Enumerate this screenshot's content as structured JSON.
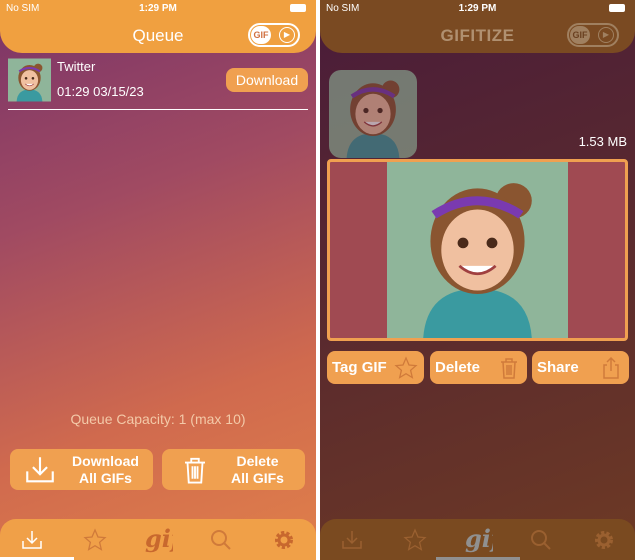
{
  "status": {
    "carrier": "No SIM",
    "time": "1:29 PM"
  },
  "queue_screen": {
    "title": "Queue",
    "toggle_label": "GIF",
    "items": [
      {
        "source": "Twitter",
        "timestamp": "01:29 03/15/23",
        "button": "Download"
      }
    ],
    "capacity": "Queue Capacity: 1 (max 10)",
    "download_all": {
      "line1": "Download",
      "line2": "All GIFs"
    },
    "delete_all": {
      "line1": "Delete",
      "line2": "All GIFs"
    }
  },
  "gifitize_screen": {
    "title": "GIFITIZE",
    "toggle_label": "GIF",
    "file_size": "1.53 MB",
    "actions": [
      {
        "label": "Tag GIF",
        "icon": "star-icon"
      },
      {
        "label": "Delete",
        "icon": "trash-icon"
      },
      {
        "label": "Share",
        "icon": "share-icon"
      }
    ]
  },
  "tabbar": [
    "download-icon",
    "star-icon",
    "gif-icon",
    "search-icon",
    "gear-icon"
  ],
  "colors": {
    "accent": "#f0a050",
    "header": "#f0a040"
  }
}
